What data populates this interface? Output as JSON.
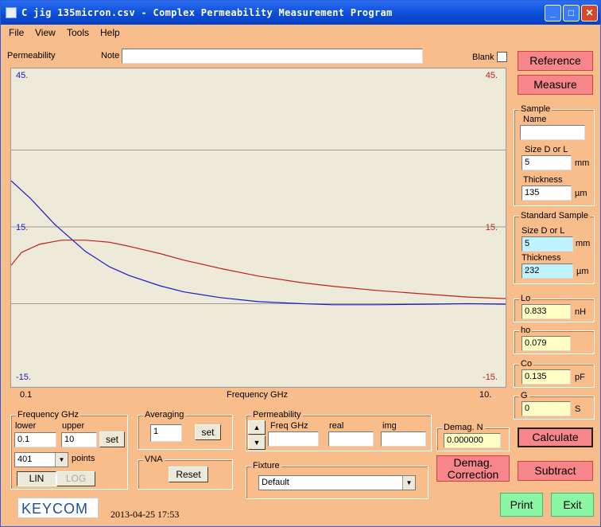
{
  "window": {
    "title": "C jig 135micron.csv - Complex Permeability Measurement Program"
  },
  "menu": [
    "File",
    "View",
    "Tools",
    "Help"
  ],
  "top": {
    "permeability_label": "Permeability",
    "note_label": "Note",
    "note_value": "",
    "blank_label": "Blank"
  },
  "buttons": {
    "reference": "Reference",
    "measure": "Measure",
    "calculate": "Calculate",
    "demag_line1": "Demag.",
    "demag_line2": "Correction",
    "subtract": "Subtract",
    "print": "Print",
    "exit": "Exit",
    "set_freq": "set",
    "set_avg": "set",
    "reset": "Reset",
    "lin": "LIN",
    "log": "LOG"
  },
  "sample": {
    "group": "Sample",
    "name_label": "Name",
    "name_value": "",
    "size_label": "Size D or L",
    "size_value": "5",
    "size_unit": "mm",
    "thick_label": "Thickness",
    "thick_value": "135",
    "thick_unit": "µm"
  },
  "standard": {
    "group": "Standard Sample",
    "size_label": "Size D or L",
    "size_value": "5",
    "size_unit": "mm",
    "thick_label": "Thickness",
    "thick_value": "232",
    "thick_unit": "µm"
  },
  "params": {
    "lo": {
      "label": "Lo",
      "value": "0.833",
      "unit": "nH"
    },
    "ho": {
      "label": "ho",
      "value": "0.079",
      "unit": ""
    },
    "co": {
      "label": "Co",
      "value": "0.135",
      "unit": "pF"
    },
    "g": {
      "label": "G",
      "value": "0",
      "unit": "S"
    }
  },
  "freq": {
    "group": "Frequency GHz",
    "lower_label": "lower",
    "upper_label": "upper",
    "lower_value": "0.1",
    "upper_value": "10",
    "points_value": "401",
    "points_label": "points"
  },
  "averaging": {
    "group": "Averaging",
    "value": "1"
  },
  "vna": {
    "group": "VNA"
  },
  "perm_panel": {
    "group": "Permeability",
    "freq_label": "Freq GHz",
    "real_label": "real",
    "img_label": "img",
    "freq_value": "",
    "real_value": "",
    "img_value": ""
  },
  "demag": {
    "label": "Demag. N",
    "value": "0.000000"
  },
  "fixture": {
    "group": "Fixture",
    "value": "Default"
  },
  "footer": {
    "logo": "KEYCOM",
    "timestamp": "2013-04-25 17:53"
  },
  "colors": {
    "blue": "#1a1acc",
    "red": "#c0201c",
    "grid": "#9a9a9a"
  },
  "chart_data": {
    "type": "line",
    "xlabel": "Frequency GHz",
    "x_ticks": [
      "0.1",
      "10."
    ],
    "xlim": [
      0.1,
      10
    ],
    "left_axis": {
      "ticks": [
        "45.",
        "15.",
        "-15."
      ],
      "ylim": [
        -15,
        45
      ],
      "color": "#1a1acc"
    },
    "right_axis": {
      "ticks": [
        "45.",
        "15.",
        "-15."
      ],
      "ylim": [
        -15,
        45
      ],
      "color": "#c0201c"
    },
    "series": [
      {
        "axis": "left",
        "color": "#1a1acc",
        "x": [
          0.1,
          0.12,
          0.15,
          0.2,
          0.25,
          0.3,
          0.4,
          0.5,
          0.7,
          1,
          1.5,
          2,
          3,
          5,
          7,
          10
        ],
        "y": [
          24,
          20.5,
          15.5,
          10.2,
          7.2,
          5.5,
          3.5,
          2.3,
          1.2,
          0.4,
          0.0,
          -0.2,
          -0.2,
          -0.1,
          0.0,
          -0.1
        ]
      },
      {
        "axis": "right",
        "color": "#c0201c",
        "x": [
          0.1,
          0.11,
          0.13,
          0.16,
          0.2,
          0.25,
          0.3,
          0.4,
          0.5,
          0.7,
          1,
          1.5,
          2,
          3,
          5,
          7,
          10
        ],
        "y": [
          7.5,
          10.0,
          11.6,
          12.4,
          12.4,
          12.0,
          11.2,
          9.8,
          8.5,
          6.9,
          5.4,
          4.1,
          3.4,
          2.6,
          1.8,
          1.3,
          1.0
        ]
      }
    ]
  }
}
